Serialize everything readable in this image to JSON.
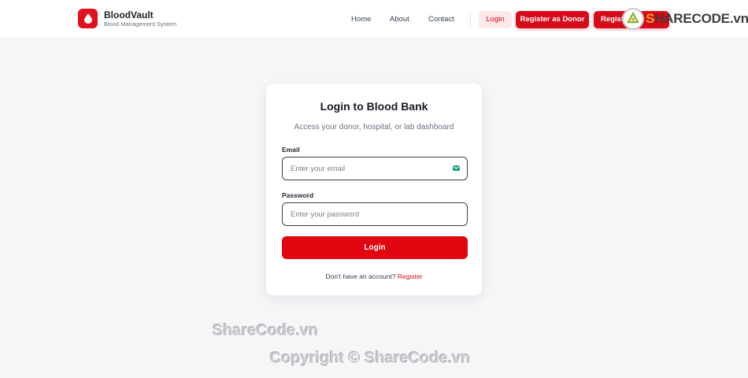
{
  "brand": {
    "name": "BloodVault",
    "subtitle": "Blood Management System",
    "logo_icon": "blood-drop-icon"
  },
  "nav": {
    "links": [
      "Home",
      "About",
      "Contact"
    ],
    "login_label": "Login",
    "register_donor_label": "Register as Donor",
    "register_other_label": "Regist"
  },
  "card": {
    "title": "Login to Blood Bank",
    "subtitle": "Access your donor, hospital, or lab dashboard",
    "email_label": "Email",
    "email_placeholder": "Enter your email",
    "password_label": "Password",
    "password_placeholder": "Enter your password",
    "submit_label": "Login",
    "footer_text": "Don't have an account?",
    "footer_link": "Register"
  },
  "watermark": {
    "logo_text_accent": "S",
    "logo_text_rest": "HARECODE.vn",
    "line1": "ShareCode.vn",
    "line2": "Copyright © ShareCode.vn"
  },
  "colors": {
    "brand_red": "#e0101e",
    "link_red": "#d20f1f",
    "background": "#f5f6f8"
  }
}
